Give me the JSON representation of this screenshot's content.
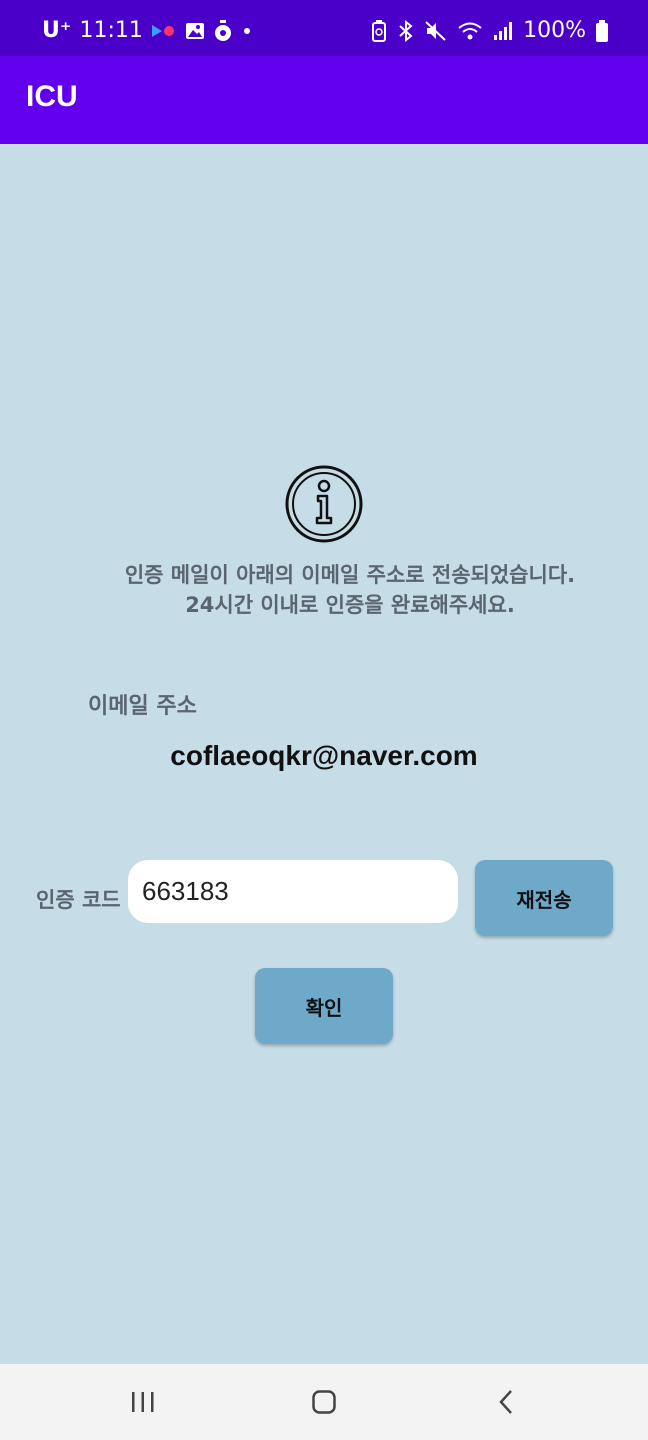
{
  "status_bar": {
    "carrier": "U⁺",
    "time": "11:11",
    "battery_text": "100%",
    "icons": [
      "media-play-icon",
      "photo-icon",
      "alarm-icon",
      "dot-icon",
      "battery-saver-icon",
      "bluetooth-icon",
      "mute-icon",
      "wifi-icon",
      "signal-icon",
      "battery-icon"
    ]
  },
  "app_bar": {
    "title": "ICU"
  },
  "main": {
    "message_line1": "인증 메일이 아래의 이메일 주소로 전송되었습니다.",
    "message_line2": "24시간 이내로 인증을 완료해주세요.",
    "email_label": "이메일 주소",
    "email_value": "coflaeoqkr@naver.com",
    "code_label": "인증 코드",
    "code_value": "663183",
    "resend_label": "재전송",
    "confirm_label": "확인"
  },
  "nav_bar": {
    "icons": [
      "recents-icon",
      "home-icon",
      "back-icon"
    ]
  },
  "colors": {
    "status_bar": "#4a00c8",
    "app_bar": "#6200ee",
    "background": "#c6dde8",
    "button": "#6fa9c9"
  }
}
